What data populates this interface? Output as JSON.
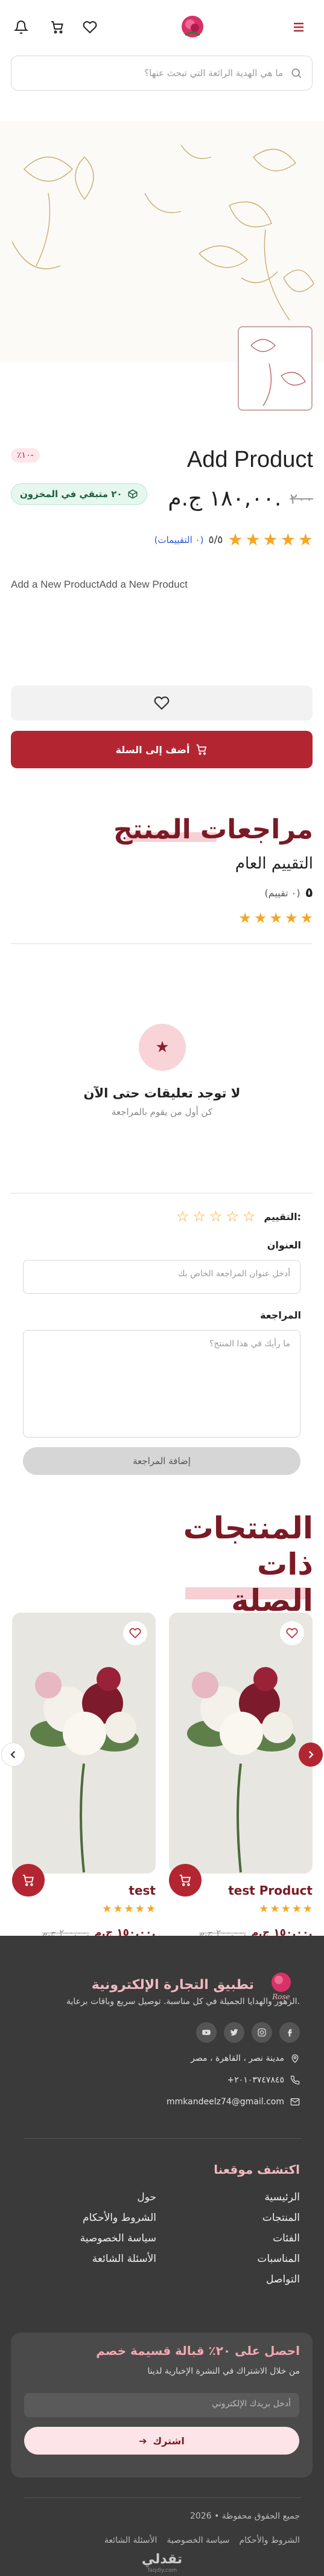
{
  "header": {
    "search_placeholder": "ما هي الهدية الرائعة التي تبحث عنها؟"
  },
  "product": {
    "title": "Add Product",
    "discount_badge": "٪١٠-",
    "price": "١٨٠,٠٠ ج.م.",
    "old_price": "٢٠٠",
    "stock": "٢٠ متبقي في المخزون",
    "rating": "٥/٥",
    "rating_count": "(٠ التقييمات)",
    "rating_value": 5,
    "description": "Add a New ProductAdd a New Product",
    "add_to_cart": "أضف إلى السلة"
  },
  "reviews": {
    "title": "مراجعات المنتج",
    "overall_label": "التقييم العام",
    "overall_score": "٥",
    "overall_count": "(٠ تقييم)",
    "empty_title": "لا توجد تعليقات حتى الآن",
    "empty_sub": "كن أول من يقوم بالمراجعة",
    "form": {
      "rating_label": "التقييم:",
      "title_label": "العنوان",
      "title_placeholder": "أدخل عنوان المراجعة الخاص بك",
      "review_label": "المراجعة",
      "review_placeholder": "ما رأيك في هذا المنتج؟",
      "submit": "إضافة المراجعة"
    }
  },
  "related": {
    "title": "المنتجات ذات الصلة",
    "title_lines": [
      "المنتجات",
      "ذات",
      "الصلة"
    ],
    "items": [
      {
        "name": "test Product",
        "price": "١٥٠,٠٠ ج.م.",
        "old_price": "٢٠٠,٠٠ ج.م.",
        "rating": 5
      },
      {
        "name": "test",
        "price": "١٥٠,٠٠ ج.م.",
        "old_price": "٢٠٠,٠٠ ج.م.",
        "rating": 5
      }
    ]
  },
  "footer": {
    "brand_title": "تطبيق التجارة الإلكترونية",
    "logo_text": "Rose",
    "tagline": "الزهور والهدايا الجميلة في كل مناسبة. توصيل سريع وباقات برعاية.",
    "address": "مدينة نصر ، القاهرة ، مصر",
    "phone": "+٢٠١٠٣٧٤٧٨٤٥",
    "email": "mmkandeelz74@gmail.com",
    "links_title": "اكتشف موقعنا",
    "links_right": [
      "الرئيسية",
      "المنتجات",
      "الفئات",
      "المناسبات",
      "التواصل"
    ],
    "links_left": [
      "حول",
      "الشروط والأحكام",
      "سياسة الخصوصية",
      "الأسئلة الشائعة"
    ],
    "newsletter_title": "احصل على ٢٠٪ قبالة قسيمة خصم",
    "newsletter_sub": "من خلال الاشتراك في النشرة الإخبارية لدينا",
    "newsletter_placeholder": "أدخل بريدك الإلكتروني",
    "newsletter_button": "اشترك",
    "copyright": "جميع الحقوق محفوظة • 2026",
    "bottom_links": [
      "الشروط والأحكام",
      "سياسة الخصوصية",
      "الأسئلة الشائعة"
    ],
    "credit": "تقدلي",
    "credit_sub": "Taqdly.com"
  },
  "colors": {
    "primary": "#b32631",
    "title": "#7a1a24",
    "star": "#f5a623",
    "footer_bg": "#3a3a3a"
  }
}
